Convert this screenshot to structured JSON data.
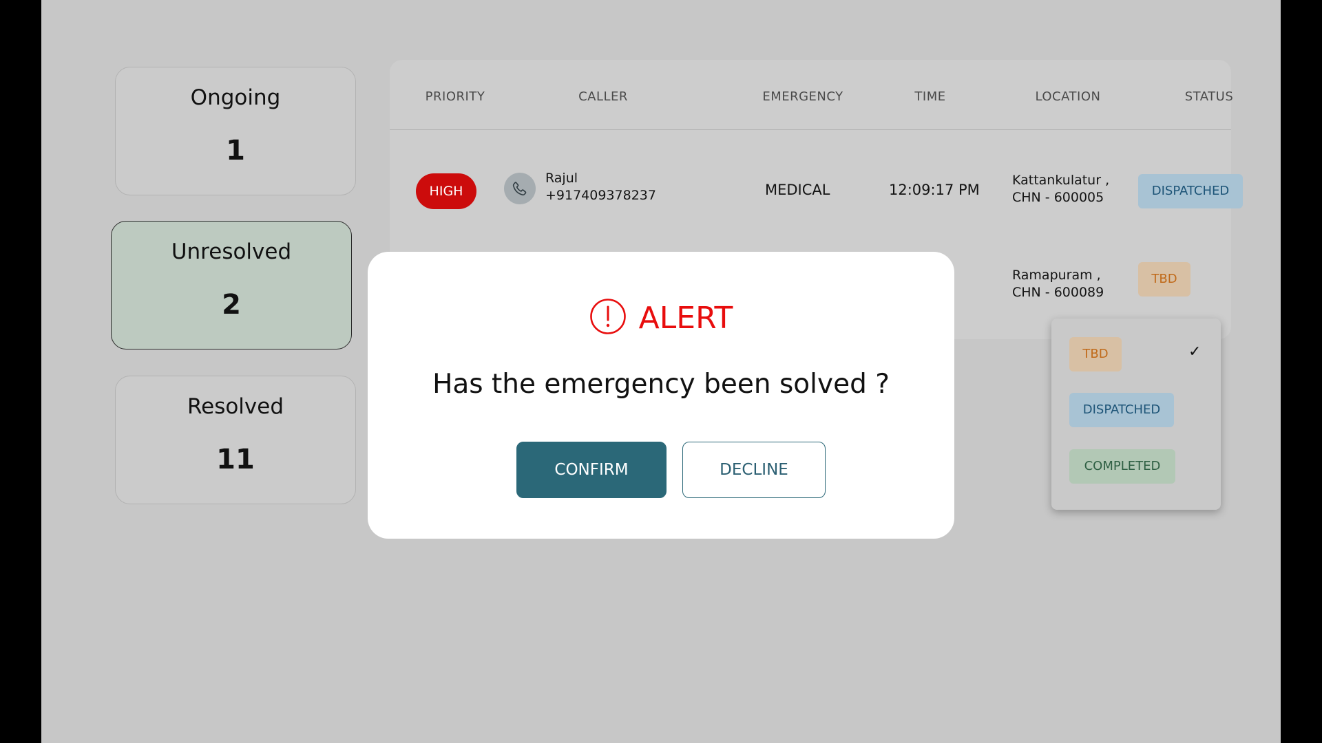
{
  "stats": [
    {
      "label": "Ongoing",
      "value": "1"
    },
    {
      "label": "Unresolved",
      "value": "2"
    },
    {
      "label": "Resolved",
      "value": "11"
    }
  ],
  "table": {
    "headers": [
      "PRIORITY",
      "CALLER",
      "EMERGENCY",
      "TIME",
      "LOCATION",
      "STATUS"
    ],
    "rows": [
      {
        "priority": "HIGH",
        "caller_name": "Rajul",
        "caller_phone": "+917409378237",
        "emergency": "MEDICAL",
        "time": "12:09:17 PM",
        "location_line1": "Kattankulatur ,",
        "location_line2": "CHN - 600005",
        "status": "DISPATCHED"
      },
      {
        "location_line1": "Ramapuram ,",
        "location_line2": "CHN - 600089",
        "status": "TBD"
      }
    ]
  },
  "status_dropdown": {
    "options": [
      "TBD",
      "DISPATCHED",
      "COMPLETED"
    ],
    "selected": "TBD"
  },
  "modal": {
    "title": "ALERT",
    "question": "Has the emergency been solved ?",
    "confirm_label": "CONFIRM",
    "decline_label": "DECLINE"
  },
  "colors": {
    "high": "#cc0c0c",
    "alert": "#e80d0d",
    "primary": "#2b6878"
  }
}
